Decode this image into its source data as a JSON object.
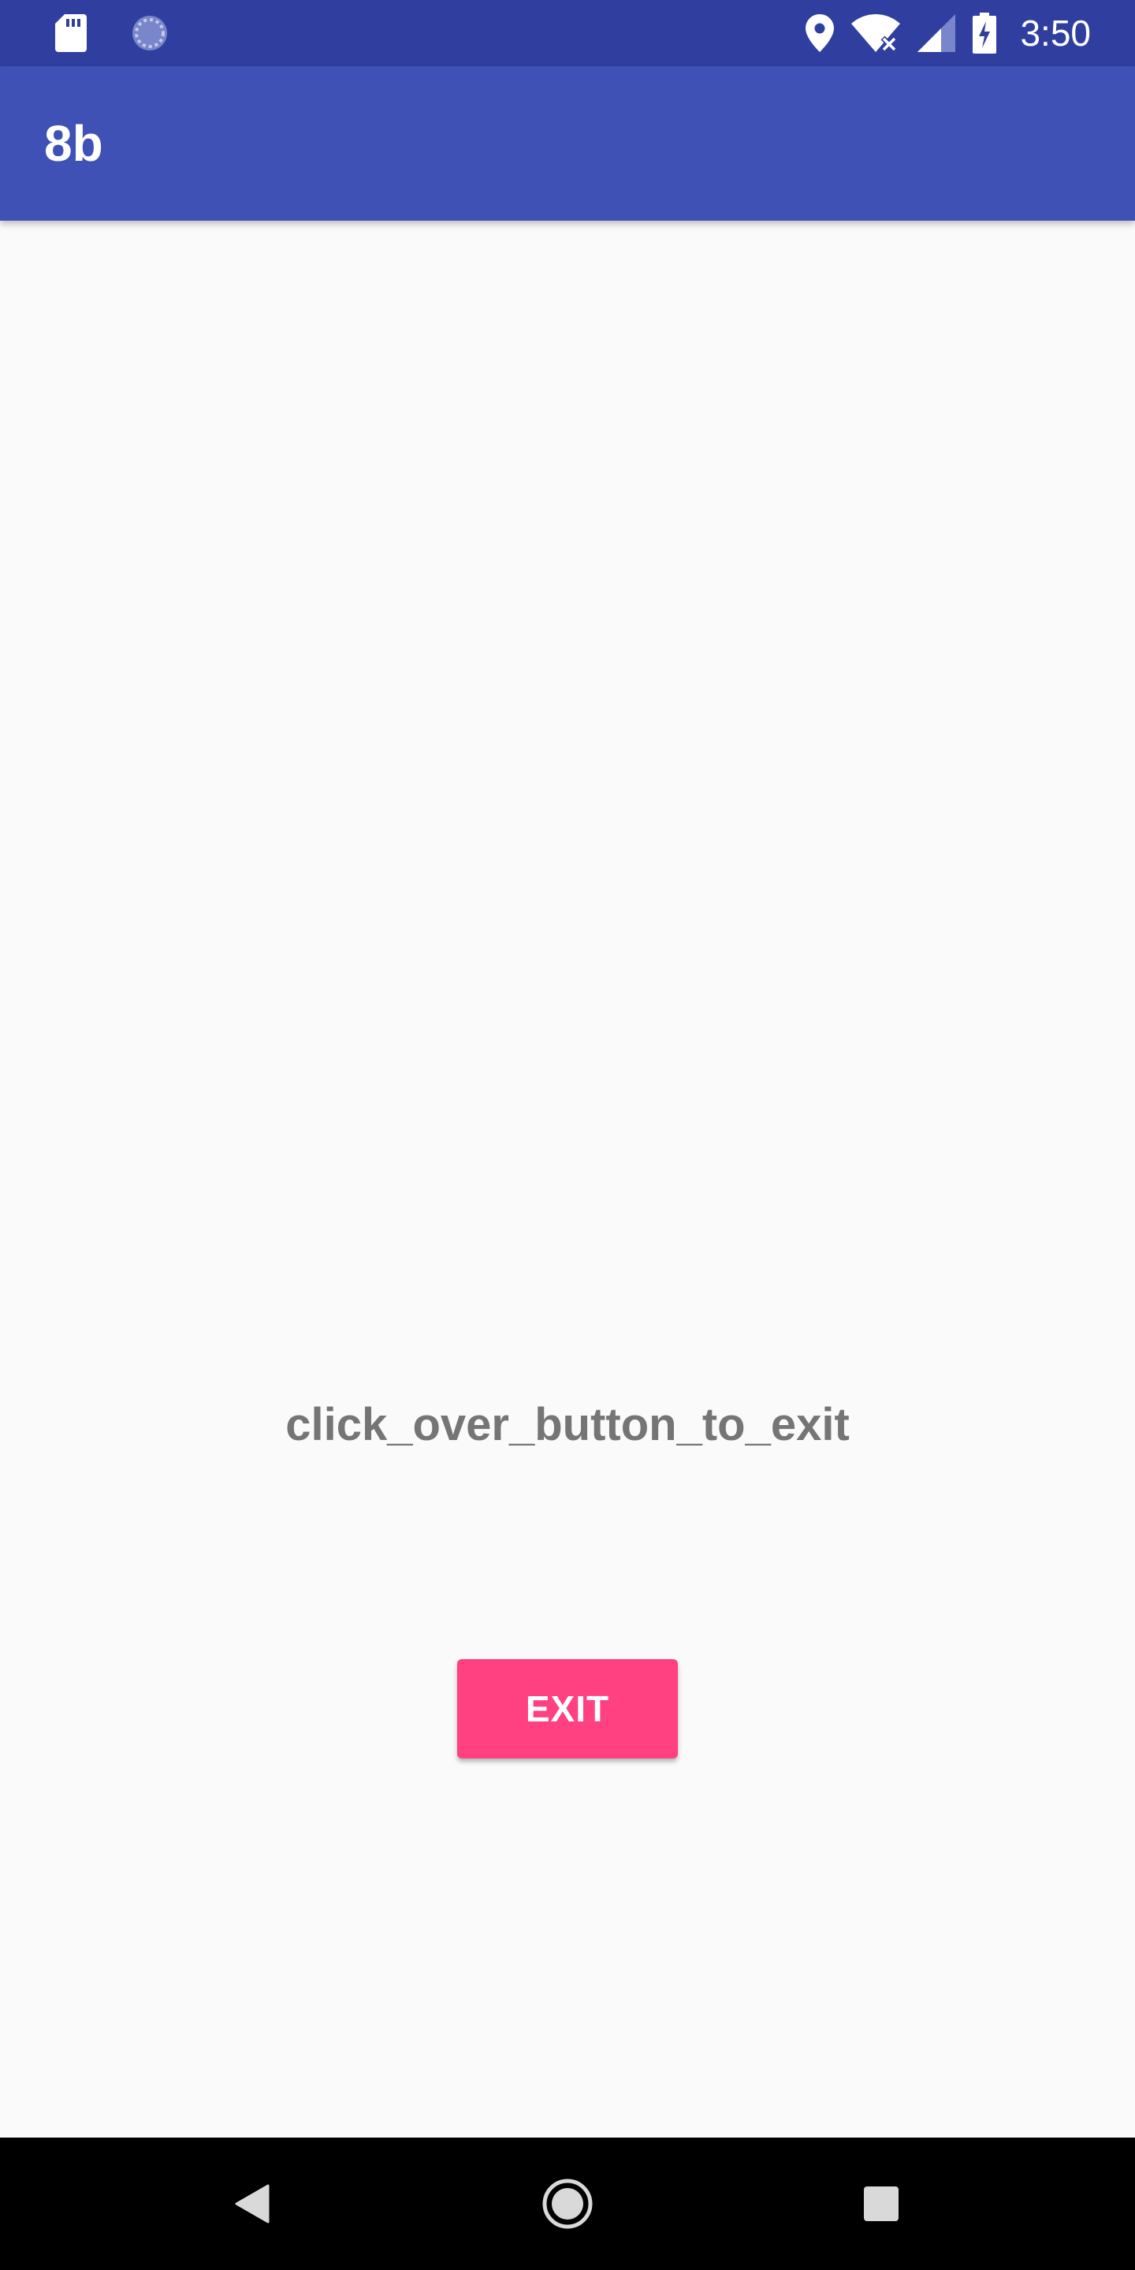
{
  "status_bar": {
    "time": "3:50",
    "left_icons": [
      "sd-card-icon",
      "sync-icon"
    ],
    "right_icons": [
      "location-icon",
      "wifi-icon",
      "signal-icon",
      "battery-charging-icon"
    ],
    "background_color": "#303f9f"
  },
  "app_bar": {
    "title": "8b",
    "background_color": "#3f51b5"
  },
  "main": {
    "message": "click_over_button_to_exit",
    "exit_button_label": "EXIT",
    "accent_color": "#ff4081"
  },
  "nav_bar": {
    "icons": [
      "back-icon",
      "home-icon",
      "recents-icon"
    ]
  }
}
